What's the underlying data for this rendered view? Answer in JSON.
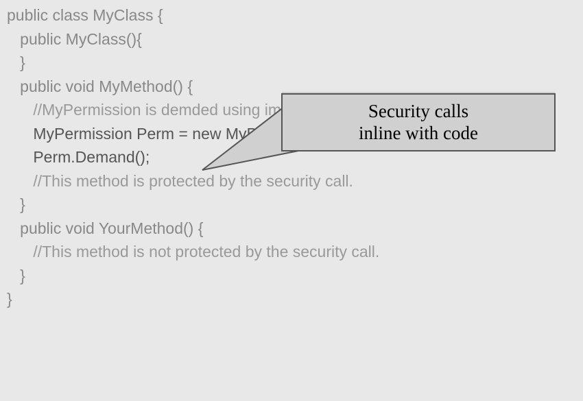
{
  "code": {
    "line1": "public class MyClass {",
    "line2": "   public MyClass(){",
    "line3": "",
    "line4": "   }",
    "line5": "",
    "line6": "   public void MyMethod() {",
    "line7a": "      //MyPermission is dem",
    "line7b": "ded using imperative syntax.",
    "line8": "      MyPermission Perm = new MyPermission();",
    "line9": "      Perm.Demand();",
    "line10": "      //This method is protected by the security call.",
    "line11": "   }",
    "line12": "",
    "line13": "   public void YourMethod() {",
    "line14": "      //This method is not protected by the security call.",
    "line15": "   }",
    "line16": "}"
  },
  "callout": {
    "line1": "Security calls",
    "line2": "inline with code"
  }
}
